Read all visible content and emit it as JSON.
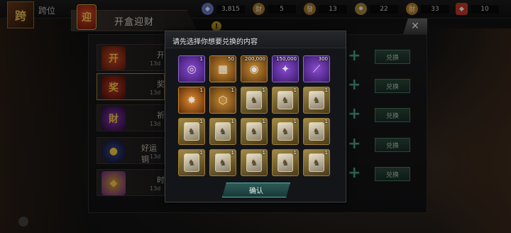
{
  "player": {
    "name": "跨位",
    "avatar_text": "跨"
  },
  "resources": [
    {
      "icon": "gem-icon",
      "value": "3,815",
      "color": "#6a7ac8"
    },
    {
      "icon": "fortune-coin-icon",
      "value": "5",
      "color": "#a87a2a"
    },
    {
      "icon": "silver-coin-icon",
      "value": "13",
      "color": "#a87a2a"
    },
    {
      "icon": "token-icon",
      "value": "22",
      "color": "#a88a3a"
    },
    {
      "icon": "medal-icon",
      "value": "33",
      "color": "#b8862a"
    },
    {
      "icon": "red-envelope-icon",
      "value": "10",
      "color": "#c83a2a"
    }
  ],
  "main": {
    "title": "开盒迎财",
    "title_badge": "迎",
    "info": "!",
    "close": "✕",
    "rows": [
      {
        "label": "开",
        "timer": "13d",
        "icon_text": "开"
      },
      {
        "label": "奖",
        "timer": "13d",
        "icon_text": "奖"
      },
      {
        "label": "祈",
        "timer": "13d",
        "icon_text": "財"
      },
      {
        "label": "好运铜",
        "timer": "13d",
        "icon_text": "●"
      },
      {
        "label": "时",
        "timer": "13d",
        "icon_text": "◆"
      }
    ],
    "exchange_label": "兑换"
  },
  "modal": {
    "title": "请先选择你想要兑换的内容",
    "confirm": "确认",
    "items": [
      {
        "kind": "purple",
        "glyph": "◎",
        "qty": "1"
      },
      {
        "kind": "gold",
        "glyph": "▦",
        "qty": "50"
      },
      {
        "kind": "gold",
        "glyph": "◉",
        "qty": "200,000"
      },
      {
        "kind": "purple",
        "glyph": "✦",
        "qty": "150,000"
      },
      {
        "kind": "purple",
        "glyph": "⟋",
        "qty": "300"
      },
      {
        "kind": "orange",
        "glyph": "✸",
        "qty": "1"
      },
      {
        "kind": "gold",
        "glyph": "⬡",
        "qty": "1"
      },
      {
        "kind": "card",
        "glyph": "♞",
        "qty": "1"
      },
      {
        "kind": "card",
        "glyph": "♞",
        "qty": "1"
      },
      {
        "kind": "card",
        "glyph": "♞",
        "qty": "1"
      },
      {
        "kind": "card",
        "glyph": "♞",
        "qty": "1"
      },
      {
        "kind": "card",
        "glyph": "♞",
        "qty": "1"
      },
      {
        "kind": "card",
        "glyph": "♞",
        "qty": "1"
      },
      {
        "kind": "card",
        "glyph": "♞",
        "qty": "1"
      },
      {
        "kind": "card",
        "glyph": "♞",
        "qty": "1"
      },
      {
        "kind": "card",
        "glyph": "♞",
        "qty": "1"
      },
      {
        "kind": "card",
        "glyph": "♞",
        "qty": "1"
      },
      {
        "kind": "card",
        "glyph": "♞",
        "qty": "1"
      },
      {
        "kind": "card",
        "glyph": "♞",
        "qty": "1"
      },
      {
        "kind": "card",
        "glyph": "♞",
        "qty": "1"
      }
    ]
  }
}
